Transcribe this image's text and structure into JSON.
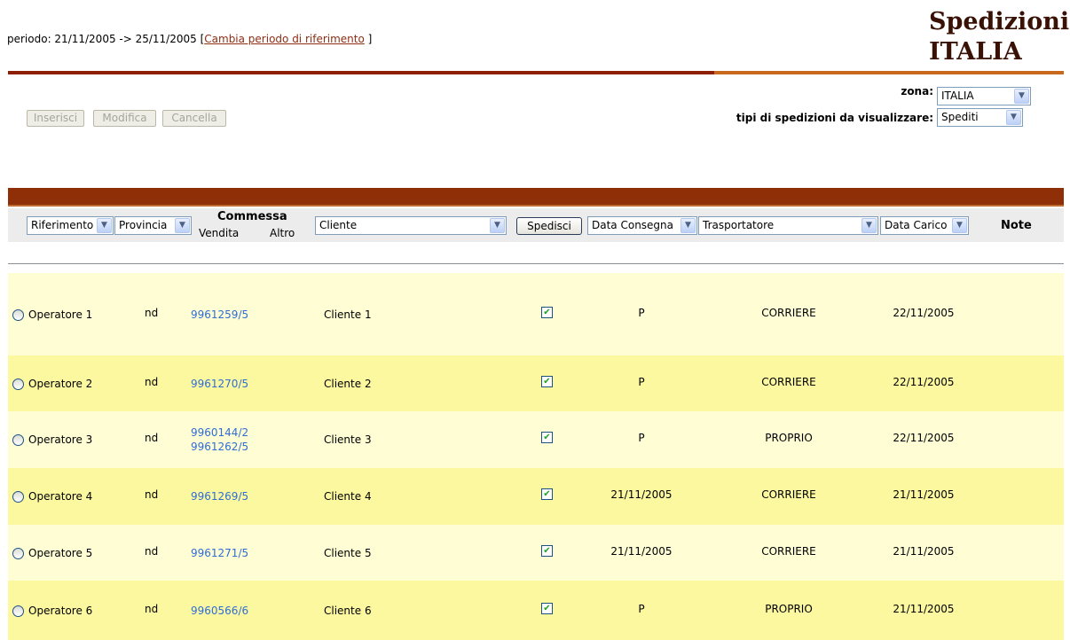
{
  "header": {
    "period_text": "periodo: 21/11/2005 -> 25/11/2005 [",
    "period_link": "Cambia periodo di riferimento",
    "period_close": " ]",
    "brand_line1": "Spedizioni",
    "brand_line2": "ITALIA"
  },
  "actions": {
    "insert": "Inserisci",
    "edit": "Modifica",
    "delete": "Cancella"
  },
  "filters": {
    "zona_label": "zona:",
    "zona_value": "ITALIA",
    "tipi_label": "tipi di spedizioni da visualizzare:",
    "tipi_value": "Spediti"
  },
  "columns": {
    "riferimento": "Riferimento",
    "provincia": "Provincia",
    "commessa": "Commessa",
    "vendita": "Vendita",
    "altro": "Altro",
    "cliente": "Cliente",
    "spedisci": "Spedisci",
    "data_consegna": "Data Consegna",
    "trasportatore": "Trasportatore",
    "data_carico": "Data Carico",
    "note": "Note"
  },
  "rows": [
    {
      "operatore": "Operatore 1",
      "provincia": "nd",
      "commessa": [
        "9961259/5"
      ],
      "cliente": "Cliente 1",
      "spedito": true,
      "consegna": "P",
      "trasportatore": "CORRIERE",
      "carico": "22/11/2005"
    },
    {
      "operatore": "Operatore 2",
      "provincia": "nd",
      "commessa": [
        "9961270/5"
      ],
      "cliente": "Cliente 2",
      "spedito": true,
      "consegna": "P",
      "trasportatore": "CORRIERE",
      "carico": "22/11/2005"
    },
    {
      "operatore": "Operatore 3",
      "provincia": "nd",
      "commessa": [
        "9960144/2",
        "9961262/5"
      ],
      "cliente": "Cliente 3",
      "spedito": true,
      "consegna": "P",
      "trasportatore": "PROPRIO",
      "carico": "22/11/2005"
    },
    {
      "operatore": "Operatore 4",
      "provincia": "nd",
      "commessa": [
        "9961269/5"
      ],
      "cliente": "Cliente 4",
      "spedito": true,
      "consegna": "21/11/2005",
      "trasportatore": "CORRIERE",
      "carico": "21/11/2005"
    },
    {
      "operatore": "Operatore 5",
      "provincia": "nd",
      "commessa": [
        "9961271/5"
      ],
      "cliente": "Cliente 5",
      "spedito": true,
      "consegna": "21/11/2005",
      "trasportatore": "CORRIERE",
      "carico": "21/11/2005"
    },
    {
      "operatore": "Operatore 6",
      "provincia": "nd",
      "commessa": [
        "9960566/6"
      ],
      "cliente": "Cliente 6",
      "spedito": true,
      "consegna": "P",
      "trasportatore": "PROPRIO",
      "carico": "21/11/2005"
    }
  ],
  "colors": {
    "row_light": "#fefdd4",
    "row_dark": "#fcf8a0",
    "link": "#2f6dd6",
    "brand_bar": "#8f2f07"
  }
}
